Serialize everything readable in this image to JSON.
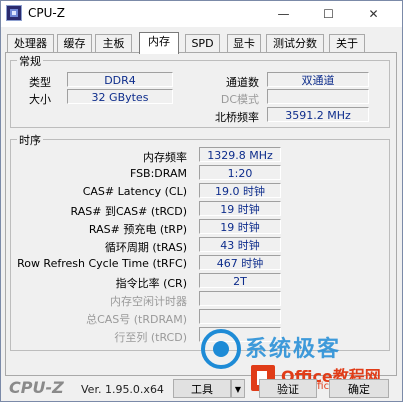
{
  "window": {
    "title": "CPU-Z",
    "minimize": "—",
    "maximize": "☐",
    "close": "✕"
  },
  "tabs": [
    {
      "label": "处理器"
    },
    {
      "label": "缓存"
    },
    {
      "label": "主板"
    },
    {
      "label": "内存",
      "active": true
    },
    {
      "label": "SPD"
    },
    {
      "label": "显卡"
    },
    {
      "label": "测试分数"
    },
    {
      "label": "关于"
    }
  ],
  "general": {
    "title": "常规",
    "type_label": "类型",
    "type_value": "DDR4",
    "size_label": "大小",
    "size_value": "32 GBytes",
    "channels_label": "通道数",
    "channels_value": "双通道",
    "dcmode_label": "DC模式",
    "dcmode_value": "",
    "nb_freq_label": "北桥频率",
    "nb_freq_value": "3591.2 MHz"
  },
  "timings": {
    "title": "时序",
    "rows": [
      {
        "label": "内存频率",
        "value": "1329.8 MHz",
        "enabled": true
      },
      {
        "label": "FSB:DRAM",
        "value": "1:20",
        "enabled": true
      },
      {
        "label": "CAS# Latency (CL)",
        "value": "19.0 时钟",
        "enabled": true
      },
      {
        "label": "RAS# 到CAS# (tRCD)",
        "value": "19 时钟",
        "enabled": true
      },
      {
        "label": "RAS# 预充电 (tRP)",
        "value": "19 时钟",
        "enabled": true
      },
      {
        "label": "循环周期 (tRAS)",
        "value": "43 时钟",
        "enabled": true
      },
      {
        "label": "Row Refresh Cycle Time (tRFC)",
        "value": "467 时钟",
        "enabled": true
      },
      {
        "label": "指令比率 (CR)",
        "value": "2T",
        "enabled": true
      },
      {
        "label": "内存空闲计时器",
        "value": "",
        "enabled": false
      },
      {
        "label": "总CAS号 (tRDRAM)",
        "value": "",
        "enabled": false
      },
      {
        "label": "行至列 (tRCD)",
        "value": "",
        "enabled": false
      }
    ]
  },
  "footer": {
    "logo": "CPU-Z",
    "version": "Ver. 1.95.0.x64",
    "tools_label": "工具",
    "tools_dropdown": "▼",
    "validate_label": "验证",
    "ok_label": "确定"
  },
  "watermark": {
    "text": "系统极客",
    "office_text": "Office教程网",
    "url": "www.office26.com"
  },
  "colors": {
    "value_text": "#0e2d8c",
    "disabled_text": "#9a9a9a",
    "watermark_blue": "#1e8bd6",
    "watermark_red": "#e03c18"
  }
}
